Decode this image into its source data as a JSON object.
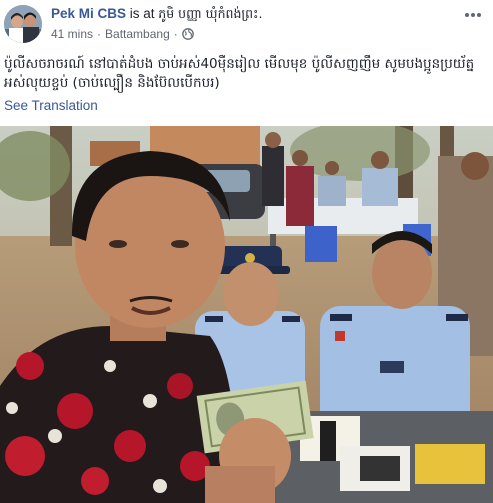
{
  "post": {
    "author": "Pek Mi CBS",
    "action": " is at ",
    "place": "ភូមិ បញ្ញា ឃុំកំពង់ព្រះ.",
    "time": "41 mins",
    "location": "Battambang",
    "separator": "·",
    "text": "ប៉ូលីសចរាចរណ៍ នៅបាត់ដំបង ចាប់អស់40ម៉ឺនរៀល មើលមុខ ប៉ូលីសញញឹម សូមបងប្អូនប្រយ័ត្នអស់លុយខ្ចប់ (ចាប់ល្បឿន និងប៊ែលបើកបរ)",
    "see_translation": "See Translation"
  },
  "icons": {
    "privacy": "globe-icon",
    "menu": "more-options-icon"
  },
  "colors": {
    "link": "#385898",
    "text": "#1d2129",
    "meta": "#616770",
    "police_uniform": "#a9c3e6",
    "shirt_red": "#b5162a",
    "banknote": "#c9d2a8"
  }
}
